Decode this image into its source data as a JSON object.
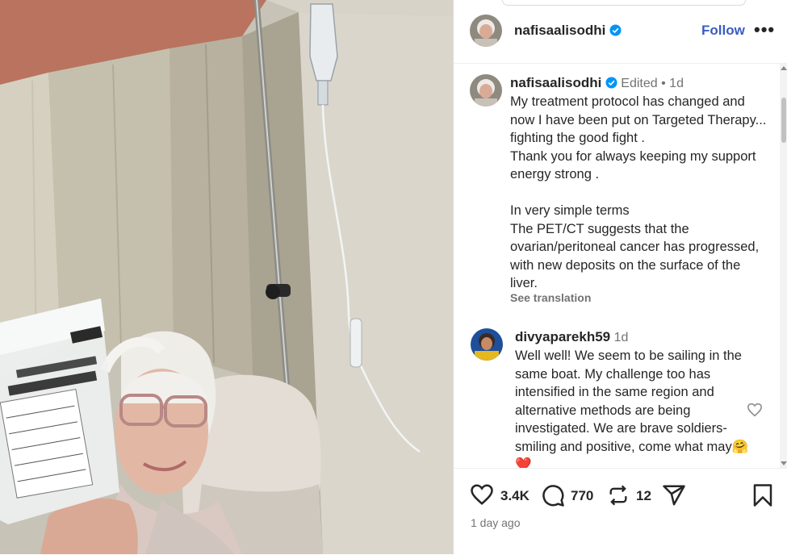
{
  "post": {
    "author": "nafisaalisodhi",
    "follow_label": "Follow",
    "more_label": "•••",
    "edited_label": "Edited",
    "dot": "•",
    "caption_age": "1d",
    "caption": "My treatment protocol has changed and now I have been put on Targeted Therapy... fighting the good fight .\nThank you for always keeping my support energy strong .\n\nIn very simple terms\nThe PET/CT suggests that the ovarian/peritoneal cancer has progressed, with new deposits on the surface of the liver.",
    "see_translation": "See translation"
  },
  "comment": {
    "author": "divyaparekh59",
    "age": "1d",
    "text": "Well well! We seem to be sailing in the same boat. My challenge too has intensified in the same region and alternative methods are being investigated. We are brave soldiers- smiling and positive, come what may",
    "emoji": "🤗❤️"
  },
  "actions": {
    "likes": "3.4K",
    "comments": "770",
    "reposts": "12",
    "time_ago": "1 day ago"
  },
  "icons": [
    "verified-badge-icon",
    "heart-icon",
    "comment-icon",
    "repost-icon",
    "share-icon",
    "bookmark-icon",
    "heart-small-icon"
  ],
  "colors": {
    "accent": "#3a5cc2",
    "verified": "#0095f6",
    "text": "#262626",
    "muted": "#737373"
  }
}
